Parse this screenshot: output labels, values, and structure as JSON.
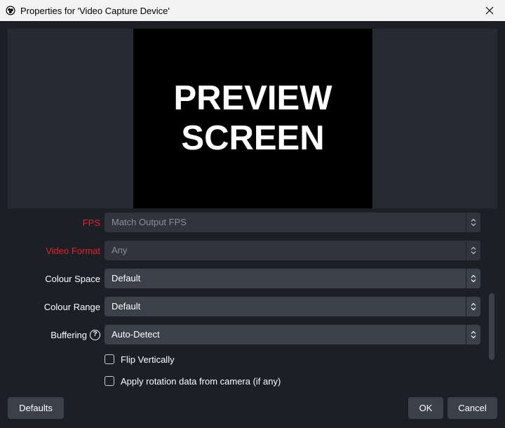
{
  "window": {
    "title": "Properties for 'Video Capture Device'",
    "app_icon": "obs-logo-icon",
    "close_icon": "close-icon"
  },
  "preview": {
    "line1": "PREVIEW",
    "line2": "SCREEN"
  },
  "properties": {
    "fps": {
      "label": "FPS",
      "value": "Match Output FPS"
    },
    "video_format": {
      "label": "Video Format",
      "value": "Any"
    },
    "colour_space": {
      "label": "Colour Space",
      "value": "Default"
    },
    "colour_range": {
      "label": "Colour Range",
      "value": "Default"
    },
    "buffering": {
      "label": "Buffering",
      "value": "Auto-Detect",
      "help_icon": "help-icon"
    },
    "flip_vertically": {
      "label": "Flip Vertically",
      "checked": false
    },
    "apply_rotation": {
      "label": "Apply rotation data from camera (if any)",
      "checked": false
    }
  },
  "buttons": {
    "defaults": "Defaults",
    "ok": "OK",
    "cancel": "Cancel"
  },
  "colors": {
    "background": "#1d1f26",
    "control": "#3c404b",
    "error_label": "#e2222b"
  }
}
